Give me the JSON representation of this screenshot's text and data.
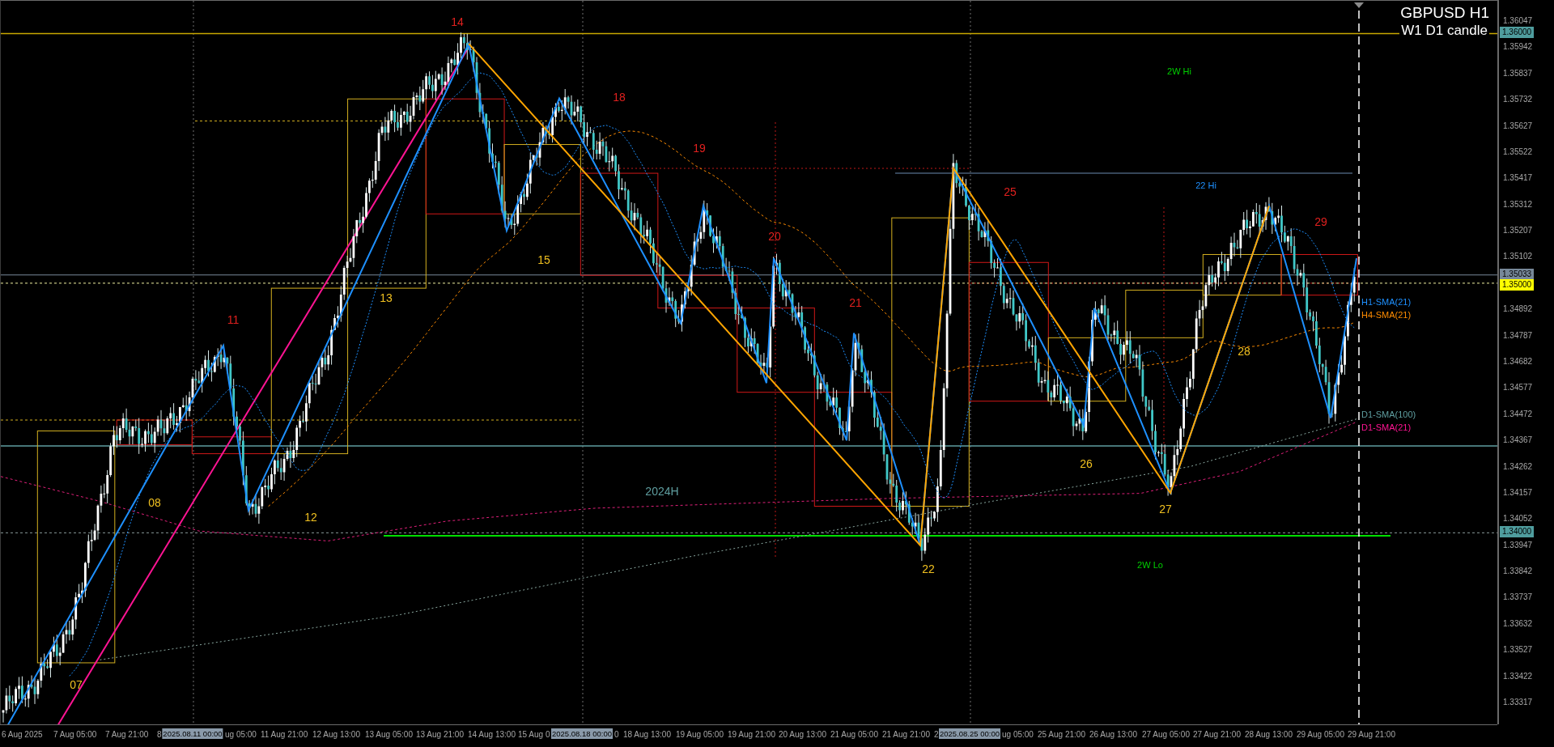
{
  "chart": {
    "title": "GBPUSD H1",
    "subtitle": "W1 D1 candle"
  },
  "annotations": [
    {
      "text": "14",
      "kind": "day",
      "color": "#e0201e"
    },
    {
      "text": "18",
      "kind": "day",
      "color": "#e0201e"
    },
    {
      "text": "19",
      "kind": "day",
      "color": "#e0201e"
    },
    {
      "text": "25",
      "kind": "day",
      "color": "#e0201e"
    },
    {
      "text": "20",
      "kind": "day",
      "color": "#e0201e"
    },
    {
      "text": "29",
      "kind": "day",
      "color": "#e0201e"
    },
    {
      "text": "21",
      "kind": "day",
      "color": "#e0201e"
    },
    {
      "text": "11",
      "kind": "day",
      "color": "#e0201e"
    },
    {
      "text": "15",
      "kind": "day",
      "color": "#f0c020"
    },
    {
      "text": "13",
      "kind": "day",
      "color": "#f0c020"
    },
    {
      "text": "28",
      "kind": "day",
      "color": "#f0c020"
    },
    {
      "text": "26",
      "kind": "day",
      "color": "#f0c020"
    },
    {
      "text": "08",
      "kind": "day",
      "color": "#f0c020"
    },
    {
      "text": "12",
      "kind": "day",
      "color": "#f0c020"
    },
    {
      "text": "27",
      "kind": "day",
      "color": "#f0c020"
    },
    {
      "text": "22",
      "kind": "day",
      "color": "#f0c020"
    },
    {
      "text": "07",
      "kind": "day",
      "color": "#f0c020"
    },
    {
      "text": "2W Hi",
      "kind": "level",
      "color": "#00d000"
    },
    {
      "text": "22 Hi",
      "kind": "level",
      "color": "#1e90ff"
    },
    {
      "text": "2024H",
      "kind": "day",
      "color": "#5f9ea0"
    },
    {
      "text": "2W Lo",
      "kind": "level",
      "color": "#00d000"
    }
  ],
  "indicator_labels": [
    {
      "text": "H1-SMA(21)",
      "color": "#1e90ff"
    },
    {
      "text": "H4-SMA(21)",
      "color": "#ff8c00"
    },
    {
      "text": "D1-SMA(100)",
      "color": "#5f9ea0"
    },
    {
      "text": "D1-SMA(21)",
      "color": "#ff1493"
    }
  ],
  "price_axis": {
    "ticks": [
      "1.36047",
      "1.35942",
      "1.35837",
      "1.35732",
      "1.35627",
      "1.35522",
      "1.35417",
      "1.35312",
      "1.35207",
      "1.35102",
      "1.34892",
      "1.34787",
      "1.34682",
      "1.34577",
      "1.34472",
      "1.34367",
      "1.34262",
      "1.34157",
      "1.34052",
      "1.33947",
      "1.33842",
      "1.33737",
      "1.33632",
      "1.33527",
      "1.33422",
      "1.33317"
    ],
    "markers": [
      {
        "text": "1.36000",
        "color": "#4f9d9e"
      },
      {
        "text": "1.35033",
        "color": "#778899"
      },
      {
        "text": "1.35000",
        "color": "#ffff00"
      },
      {
        "text": "1.34000",
        "color": "#4f9d9e"
      }
    ]
  },
  "time_axis": {
    "labels": [
      {
        "text": "6 Aug 2025",
        "kind": "tick"
      },
      {
        "text": "7 Aug 05:00",
        "kind": "tick"
      },
      {
        "text": "7 Aug 21:00",
        "kind": "tick"
      },
      {
        "text": "8",
        "kind": "tick"
      },
      {
        "text": "2025.08.11 00:00",
        "kind": "cursor"
      },
      {
        "text": "ug 05:00",
        "kind": "tick"
      },
      {
        "text": "11 Aug 21:00",
        "kind": "tick"
      },
      {
        "text": "12 Aug 13:00",
        "kind": "tick"
      },
      {
        "text": "13 Aug 05:00",
        "kind": "tick"
      },
      {
        "text": "13 Aug 21:00",
        "kind": "tick"
      },
      {
        "text": "14 Aug 13:00",
        "kind": "tick"
      },
      {
        "text": "15 Aug 0",
        "kind": "tick"
      },
      {
        "text": "2025.08.18 00:00",
        "kind": "cursor"
      },
      {
        "text": "0",
        "kind": "tick"
      },
      {
        "text": "18 Aug 13:00",
        "kind": "tick"
      },
      {
        "text": "19 Aug 05:00",
        "kind": "tick"
      },
      {
        "text": "19 Aug 21:00",
        "kind": "tick"
      },
      {
        "text": "20 Aug 13:00",
        "kind": "tick"
      },
      {
        "text": "21 Aug 05:00",
        "kind": "tick"
      },
      {
        "text": "21 Aug 21:00",
        "kind": "tick"
      },
      {
        "text": "2",
        "kind": "tick"
      },
      {
        "text": "2025.08.25 00:00",
        "kind": "cursor"
      },
      {
        "text": "ug 05:00",
        "kind": "tick"
      },
      {
        "text": "25 Aug 21:00",
        "kind": "tick"
      },
      {
        "text": "26 Aug 13:00",
        "kind": "tick"
      },
      {
        "text": "27 Aug 05:00",
        "kind": "tick"
      },
      {
        "text": "27 Aug 21:00",
        "kind": "tick"
      },
      {
        "text": "28 Aug 13:00",
        "kind": "tick"
      },
      {
        "text": "29 Aug 05:00",
        "kind": "tick"
      },
      {
        "text": "29 Aug 21:00",
        "kind": "tick"
      }
    ]
  }
}
